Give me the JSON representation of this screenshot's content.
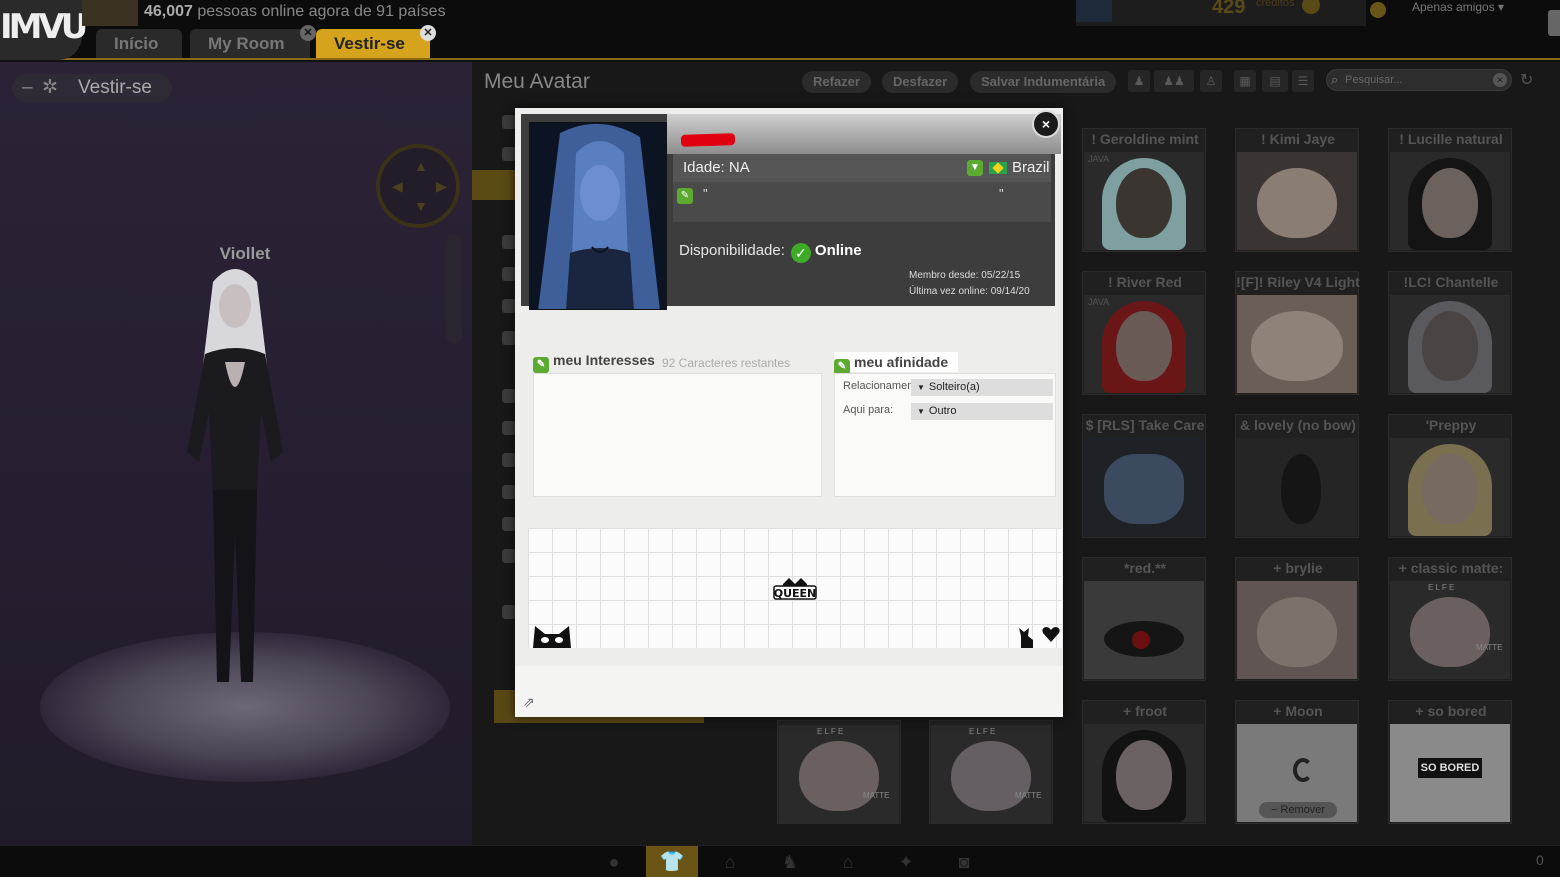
{
  "topbar": {
    "logo": "IMVU",
    "online_count": "46,007",
    "online_suffix": " pessoas online agora de 91 países",
    "tabs": [
      {
        "label": "Início"
      },
      {
        "label": "My Room"
      },
      {
        "label": "Vestir-se"
      }
    ],
    "credits": "429",
    "credits_label": "créditos",
    "friends_filter": "Apenas amigos"
  },
  "left_panel": {
    "title": "Vestir-se",
    "avatar_name": "Viollet"
  },
  "toolbar": {
    "title": "Meu Avatar",
    "redo": "Refazer",
    "undo": "Desfazer",
    "save": "Salvar Indumentária",
    "search_placeholder": "Pesquisar..."
  },
  "items": [
    {
      "title": "! Geroldine mint"
    },
    {
      "title": "! Kimi Jaye"
    },
    {
      "title": "! Lucille natural"
    },
    {
      "title": "! River Red"
    },
    {
      "title": "![F]! Riley V4 Light"
    },
    {
      "title": "!LC! Chantelle"
    },
    {
      "title": "$ [RLS] Take Care"
    },
    {
      "title": "& lovely (no bow)"
    },
    {
      "title": "'Preppy"
    },
    {
      "title": "*red.**"
    },
    {
      "title": "+ brylie"
    },
    {
      "title": "+ classic matte:"
    },
    {
      "title": ""
    },
    {
      "title": ""
    },
    {
      "title": "+ froot"
    },
    {
      "title": "+ Moon"
    },
    {
      "title": "+ so bored"
    }
  ],
  "item_labels": {
    "remover": "Remover",
    "elfe": "E L F E",
    "matte": "MATTE",
    "java": "JAVA",
    "so_bored": "SO BORED"
  },
  "profile": {
    "age": "Idade: NA",
    "country": "Brazil",
    "quote_open": "\"",
    "quote_close": "\"",
    "availability_label": "Disponibilidade:",
    "availability_value": "Online",
    "member_since": "Membro desde: 05/22/15",
    "last_online": "Última vez online: 09/14/20",
    "interests_title": "meu Interesses",
    "chars_left": "92 Caracteres restantes",
    "affinity_title": "meu afinidade",
    "relationship_label": "Relacionamento:",
    "relationship_value": "Solteiro(a)",
    "here_for_label": "Aqui para:",
    "here_for_value": "Outro",
    "sticker_text": "QUEEN",
    "close": "×"
  },
  "bottombar": {
    "right_text": "0"
  },
  "colors": {
    "accent": "#d6a31c",
    "online_green": "#3eaa2a",
    "edit_green": "#5daa32"
  }
}
